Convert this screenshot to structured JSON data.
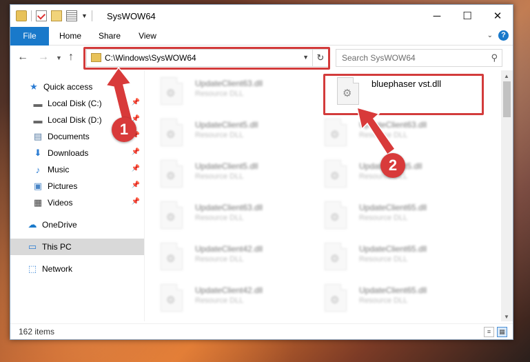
{
  "window": {
    "title": "SysWOW64",
    "minimize": "─",
    "maximize": "☐",
    "close": "✕"
  },
  "ribbon": {
    "tabs": [
      "File",
      "Home",
      "Share",
      "View"
    ],
    "help": "?"
  },
  "address_bar": {
    "path": "C:\\Windows\\SysWOW64"
  },
  "search": {
    "placeholder": "Search SysWOW64"
  },
  "sidebar": {
    "items": [
      {
        "label": "Quick access",
        "icon": "star-icon",
        "glyph": "★"
      },
      {
        "label": "Local Disk (C:)",
        "icon": "drive-icon",
        "glyph": "▬"
      },
      {
        "label": "Local Disk (D:)",
        "icon": "drive-icon",
        "glyph": "▬"
      },
      {
        "label": "Documents",
        "icon": "documents-icon",
        "glyph": "▤"
      },
      {
        "label": "Downloads",
        "icon": "downloads-icon",
        "glyph": "⬇"
      },
      {
        "label": "Music",
        "icon": "music-icon",
        "glyph": "♪"
      },
      {
        "label": "Pictures",
        "icon": "pictures-icon",
        "glyph": "▣"
      },
      {
        "label": "Videos",
        "icon": "videos-icon",
        "glyph": "▦"
      },
      {
        "label": "OneDrive",
        "icon": "onedrive-icon",
        "glyph": "☁"
      },
      {
        "label": "This PC",
        "icon": "computer-icon",
        "glyph": "▭"
      },
      {
        "label": "Network",
        "icon": "network-icon",
        "glyph": "⬚"
      }
    ]
  },
  "files": {
    "left": [
      {
        "name": "UpdateClient63.dll",
        "type": "Resource DLL"
      },
      {
        "name": "UpdateClient5.dll",
        "type": "Resource DLL"
      },
      {
        "name": "UpdateClient5.dll",
        "type": "Resource DLL"
      },
      {
        "name": "UpdateClient63.dll",
        "type": "Resource DLL"
      },
      {
        "name": "UpdateClient42.dll",
        "type": "Resource DLL"
      },
      {
        "name": "UpdateClient42.dll",
        "type": "Resource DLL"
      }
    ],
    "right": [
      {
        "name": "bluephaser vst.dll",
        "type": ""
      },
      {
        "name": "UpdateClient63.dll",
        "type": "Resource DLL"
      },
      {
        "name": "UpdateClient5.dll",
        "type": "Resource DLL"
      },
      {
        "name": "UpdateClient65.dll",
        "type": "Resource DLL"
      },
      {
        "name": "UpdateClient65.dll",
        "type": "Resource DLL"
      },
      {
        "name": "UpdateClient65.dll",
        "type": "Resource DLL"
      }
    ]
  },
  "status": {
    "item_count": "162 items"
  },
  "callouts": [
    "1",
    "2"
  ],
  "colors": {
    "accent": "#1979ca",
    "highlight": "#d33b3b"
  }
}
